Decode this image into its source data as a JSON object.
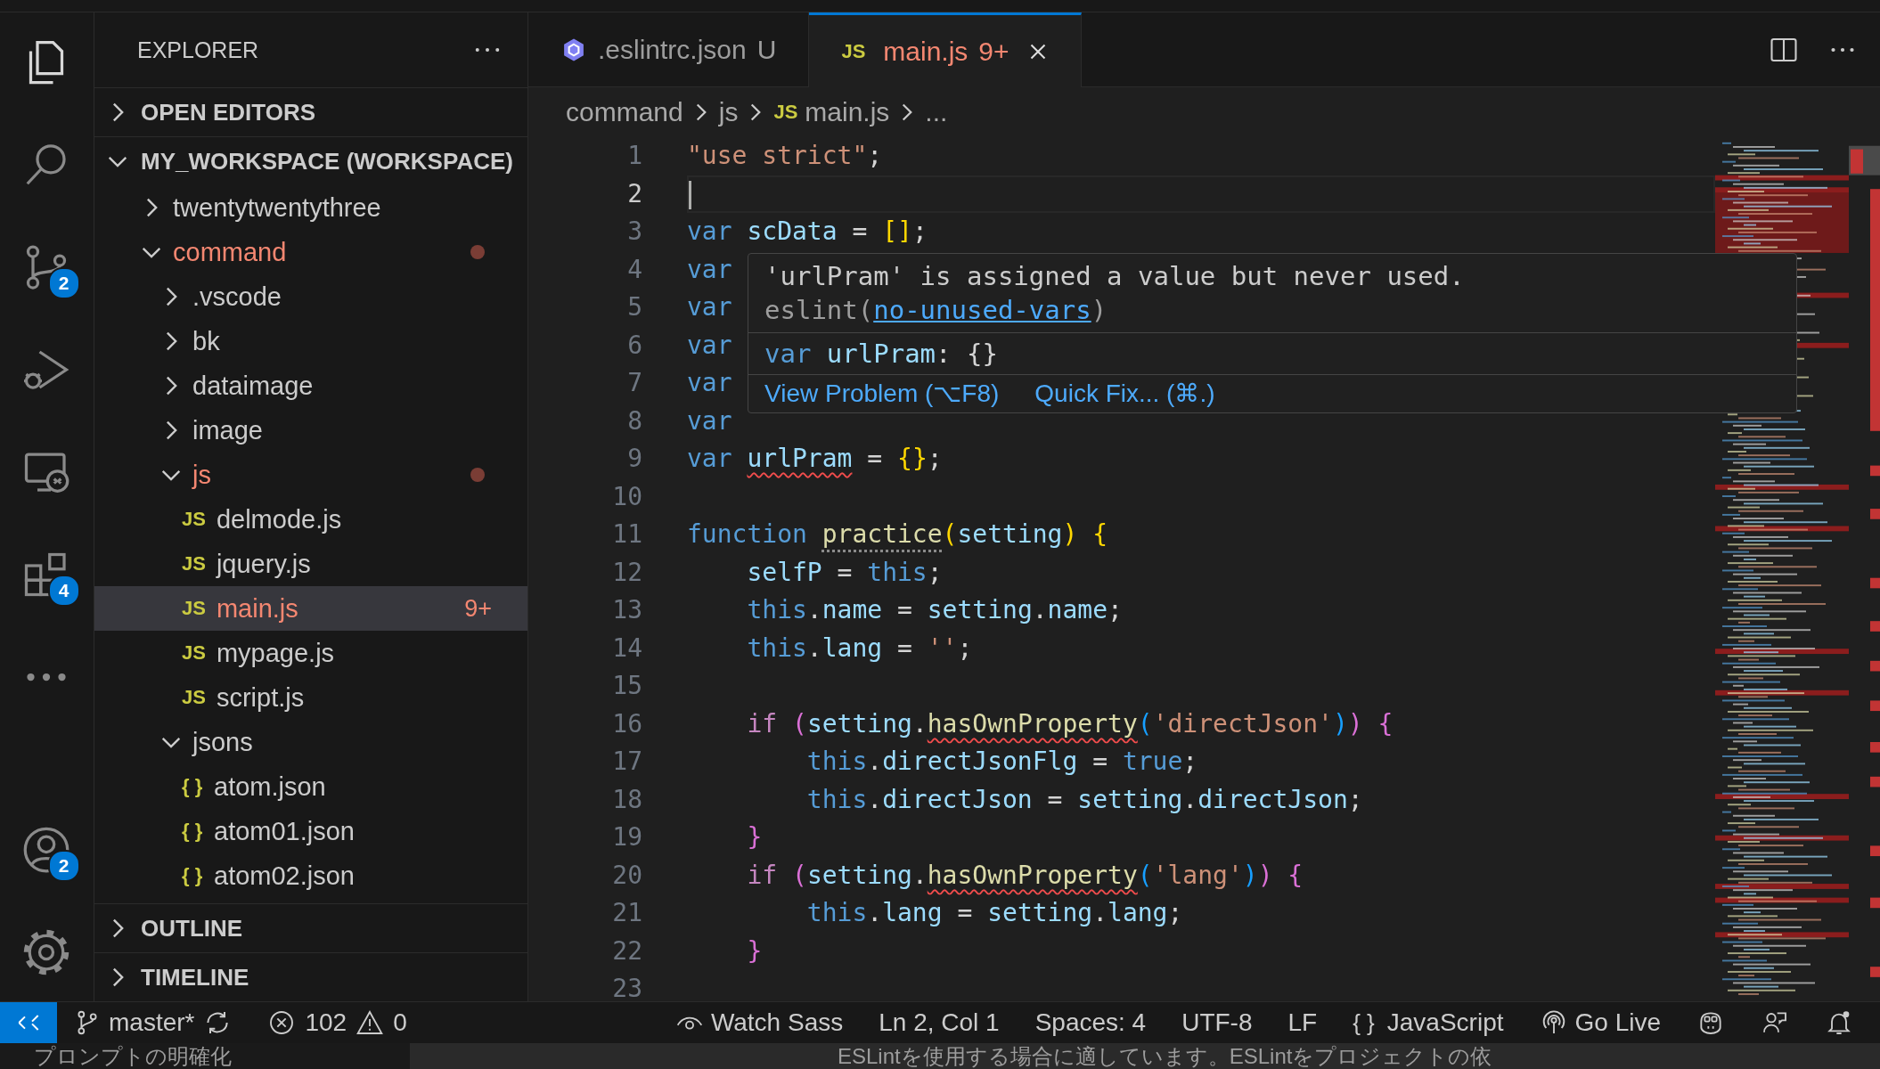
{
  "activity_bar": {
    "top": [
      {
        "kind": "explorer",
        "selected": true
      },
      {
        "kind": "search",
        "selected": false
      },
      {
        "kind": "source-control",
        "selected": false,
        "badge": "2"
      },
      {
        "kind": "run-debug",
        "selected": false
      },
      {
        "kind": "remote",
        "selected": false
      },
      {
        "kind": "extensions",
        "selected": false,
        "badge": "4"
      },
      {
        "kind": "more",
        "selected": false
      }
    ],
    "bottom": [
      {
        "kind": "accounts",
        "selected": false,
        "badge": "2"
      },
      {
        "kind": "settings",
        "selected": false
      }
    ]
  },
  "sidebar": {
    "title": "EXPLORER",
    "sections": [
      {
        "title": "OPEN EDITORS",
        "expanded": false
      },
      {
        "title": "MY_WORKSPACE (WORKSPACE)",
        "expanded": true,
        "items": [
          {
            "label": "twentytwentythree",
            "kind": "folder",
            "expanded": false,
            "selected": false,
            "modified": false
          },
          {
            "label": "command",
            "kind": "folder",
            "expanded": true,
            "selected": false,
            "modified": true,
            "children": [
              {
                "label": ".vscode",
                "kind": "folder",
                "expanded": false,
                "selected": false,
                "modified": false
              },
              {
                "label": "bk",
                "kind": "folder",
                "expanded": false,
                "selected": false,
                "modified": false
              },
              {
                "label": "dataimage",
                "kind": "folder",
                "expanded": false,
                "selected": false,
                "modified": false
              },
              {
                "label": "image",
                "kind": "folder",
                "expanded": false,
                "selected": false,
                "modified": false
              },
              {
                "label": "js",
                "kind": "folder",
                "expanded": true,
                "selected": false,
                "modified": true,
                "children": [
                  {
                    "label": "delmode.js",
                    "kind": "file",
                    "icon": "JS",
                    "selected": false,
                    "modified": false
                  },
                  {
                    "label": "jquery.js",
                    "kind": "file",
                    "icon": "JS",
                    "selected": false,
                    "modified": false
                  },
                  {
                    "label": "main.js",
                    "kind": "file",
                    "icon": "JS",
                    "selected": true,
                    "modified": true,
                    "badge": "9+"
                  },
                  {
                    "label": "mypage.js",
                    "kind": "file",
                    "icon": "JS",
                    "selected": false,
                    "modified": false
                  },
                  {
                    "label": "script.js",
                    "kind": "file",
                    "icon": "JS",
                    "selected": false,
                    "modified": false
                  }
                ]
              },
              {
                "label": "jsons",
                "kind": "folder",
                "expanded": true,
                "selected": false,
                "modified": false,
                "children": [
                  {
                    "label": "atom.json",
                    "kind": "file",
                    "icon": "{ }",
                    "selected": false,
                    "modified": false
                  },
                  {
                    "label": "atom01.json",
                    "kind": "file",
                    "icon": "{ }",
                    "selected": false,
                    "modified": false
                  },
                  {
                    "label": "atom02.json",
                    "kind": "file",
                    "icon": "{ }",
                    "selected": false,
                    "modified": false
                  }
                ]
              }
            ]
          }
        ]
      },
      {
        "title": "OUTLINE",
        "expanded": false
      },
      {
        "title": "TIMELINE",
        "expanded": false
      }
    ]
  },
  "tabs": [
    {
      "kind": "eslint",
      "label": ".eslintrc.json",
      "status": "U",
      "selected": false,
      "error": false
    },
    {
      "kind": "js",
      "icon": "JS",
      "label": "main.js",
      "status": "9+",
      "selected": true,
      "error": true
    }
  ],
  "breadcrumbs": [
    {
      "label": "command"
    },
    {
      "label": "js"
    },
    {
      "icon": "JS",
      "label": "main.js"
    },
    {
      "label": "..."
    }
  ],
  "code": [
    {
      "number": "1",
      "current": false,
      "tokens": [
        {
          "kind": "str",
          "text": "\"use strict\""
        },
        {
          "kind": "punc",
          "text": ";"
        }
      ]
    },
    {
      "number": "2",
      "current": true
    },
    {
      "number": "3",
      "current": false,
      "tokens": [
        {
          "kind": "kw",
          "text": "var "
        },
        {
          "kind": "var",
          "text": "scData"
        },
        {
          "kind": "punc",
          "text": " = "
        },
        {
          "kind": "br1",
          "text": "[]"
        },
        {
          "kind": "punc",
          "text": ";"
        }
      ]
    },
    {
      "number": "4",
      "current": false,
      "tokens": [
        {
          "kind": "kw",
          "text": "var"
        }
      ]
    },
    {
      "number": "5",
      "current": false,
      "tokens": [
        {
          "kind": "kw",
          "text": "var"
        }
      ]
    },
    {
      "number": "6",
      "current": false,
      "tokens": [
        {
          "kind": "kw",
          "text": "var"
        }
      ]
    },
    {
      "number": "7",
      "current": false,
      "tokens": [
        {
          "kind": "kw",
          "text": "var"
        }
      ]
    },
    {
      "number": "8",
      "current": false,
      "tokens": [
        {
          "kind": "kw",
          "text": "var"
        }
      ]
    },
    {
      "number": "9",
      "current": false,
      "tokens": [
        {
          "kind": "kw",
          "text": "var "
        },
        {
          "kind": "var",
          "text": "urlPram",
          "squiggle": true
        },
        {
          "kind": "punc",
          "text": " = "
        },
        {
          "kind": "br1",
          "text": "{}"
        },
        {
          "kind": "punc",
          "text": ";"
        }
      ]
    },
    {
      "number": "10",
      "current": false
    },
    {
      "number": "11",
      "current": false,
      "tokens": [
        {
          "kind": "kw",
          "text": "function "
        },
        {
          "kind": "fn",
          "text": "practice",
          "hint": true
        },
        {
          "kind": "br1",
          "text": "("
        },
        {
          "kind": "var",
          "text": "setting"
        },
        {
          "kind": "br1",
          "text": ") {"
        }
      ]
    },
    {
      "number": "12",
      "current": false,
      "tokens": [
        {
          "kind": "var",
          "text": "    selfP"
        },
        {
          "kind": "punc",
          "text": " = "
        },
        {
          "kind": "kw",
          "text": "this"
        },
        {
          "kind": "punc",
          "text": ";"
        }
      ]
    },
    {
      "number": "13",
      "current": false,
      "tokens": [
        {
          "kind": "kw",
          "text": "    this"
        },
        {
          "kind": "punc",
          "text": "."
        },
        {
          "kind": "var",
          "text": "name"
        },
        {
          "kind": "punc",
          "text": " = "
        },
        {
          "kind": "var",
          "text": "setting"
        },
        {
          "kind": "punc",
          "text": "."
        },
        {
          "kind": "var",
          "text": "name"
        },
        {
          "kind": "punc",
          "text": ";"
        }
      ]
    },
    {
      "number": "14",
      "current": false,
      "tokens": [
        {
          "kind": "kw",
          "text": "    this"
        },
        {
          "kind": "punc",
          "text": "."
        },
        {
          "kind": "var",
          "text": "lang"
        },
        {
          "kind": "punc",
          "text": " = "
        },
        {
          "kind": "str",
          "text": "''"
        },
        {
          "kind": "punc",
          "text": ";"
        }
      ]
    },
    {
      "number": "15",
      "current": false
    },
    {
      "number": "16",
      "current": false,
      "tokens": [
        {
          "kind": "ctl",
          "text": "    if "
        },
        {
          "kind": "br2",
          "text": "("
        },
        {
          "kind": "var",
          "text": "setting"
        },
        {
          "kind": "punc",
          "text": "."
        },
        {
          "kind": "fn",
          "text": "hasOwnProperty",
          "squiggle": true
        },
        {
          "kind": "br3",
          "text": "("
        },
        {
          "kind": "str",
          "text": "'directJson'"
        },
        {
          "kind": "br3",
          "text": ")"
        },
        {
          "kind": "br2",
          "text": ") {"
        }
      ]
    },
    {
      "number": "17",
      "current": false,
      "tokens": [
        {
          "kind": "kw",
          "text": "        this"
        },
        {
          "kind": "punc",
          "text": "."
        },
        {
          "kind": "var",
          "text": "directJsonFlg"
        },
        {
          "kind": "punc",
          "text": " = "
        },
        {
          "kind": "kw",
          "text": "true"
        },
        {
          "kind": "punc",
          "text": ";"
        }
      ]
    },
    {
      "number": "18",
      "current": false,
      "tokens": [
        {
          "kind": "kw",
          "text": "        this"
        },
        {
          "kind": "punc",
          "text": "."
        },
        {
          "kind": "var",
          "text": "directJson"
        },
        {
          "kind": "punc",
          "text": " = "
        },
        {
          "kind": "var",
          "text": "setting"
        },
        {
          "kind": "punc",
          "text": "."
        },
        {
          "kind": "var",
          "text": "directJson"
        },
        {
          "kind": "punc",
          "text": ";"
        }
      ]
    },
    {
      "number": "19",
      "current": false,
      "tokens": [
        {
          "kind": "br2",
          "text": "    }"
        }
      ]
    },
    {
      "number": "20",
      "current": false,
      "tokens": [
        {
          "kind": "ctl",
          "text": "    if "
        },
        {
          "kind": "br2",
          "text": "("
        },
        {
          "kind": "var",
          "text": "setting"
        },
        {
          "kind": "punc",
          "text": "."
        },
        {
          "kind": "fn",
          "text": "hasOwnProperty",
          "squiggle": true
        },
        {
          "kind": "br3",
          "text": "("
        },
        {
          "kind": "str",
          "text": "'lang'"
        },
        {
          "kind": "br3",
          "text": ")"
        },
        {
          "kind": "br2",
          "text": ") {"
        }
      ]
    },
    {
      "number": "21",
      "current": false,
      "tokens": [
        {
          "kind": "kw",
          "text": "        this"
        },
        {
          "kind": "punc",
          "text": "."
        },
        {
          "kind": "var",
          "text": "lang"
        },
        {
          "kind": "punc",
          "text": " = "
        },
        {
          "kind": "var",
          "text": "setting"
        },
        {
          "kind": "punc",
          "text": "."
        },
        {
          "kind": "var",
          "text": "lang"
        },
        {
          "kind": "punc",
          "text": ";"
        }
      ]
    },
    {
      "number": "22",
      "current": false,
      "tokens": [
        {
          "kind": "br2",
          "text": "    }"
        }
      ]
    },
    {
      "number": "23",
      "current": false
    }
  ],
  "hover": {
    "message": "'urlPram' is assigned a value but never used.",
    "source": "eslint(",
    "rule": "no-unused-vars",
    "source_end": ")",
    "signature": [
      {
        "kind": "kw",
        "text": "var "
      },
      {
        "kind": "var",
        "text": "urlPram"
      },
      {
        "kind": "punc",
        "text": ": {}"
      }
    ],
    "actions": [
      "View Problem (⌥F8)",
      "Quick Fix... (⌘.)"
    ]
  },
  "status_bar": {
    "left": [
      {
        "kind": "remote"
      },
      {
        "kind": "branch",
        "label": "master*"
      },
      {
        "kind": "sync"
      },
      {
        "kind": "problems",
        "errors": "102",
        "warnings": "0"
      }
    ],
    "right": [
      {
        "kind": "watch",
        "label": "Watch Sass"
      },
      {
        "kind": "text",
        "label": "Ln 2, Col 1"
      },
      {
        "kind": "text",
        "label": "Spaces: 4"
      },
      {
        "kind": "text",
        "label": "UTF-8"
      },
      {
        "kind": "text",
        "label": "LF"
      },
      {
        "kind": "language",
        "icon": "{ }",
        "label": "JavaScript"
      },
      {
        "kind": "golive",
        "label": "Go Live"
      },
      {
        "kind": "copilot"
      },
      {
        "kind": "feedback"
      },
      {
        "kind": "bell"
      }
    ]
  },
  "bottom_strip": {
    "left": "プロンプトの明確化",
    "right": "ESLintを使用する場合に適しています。ESLintをプロジェクトの依"
  }
}
